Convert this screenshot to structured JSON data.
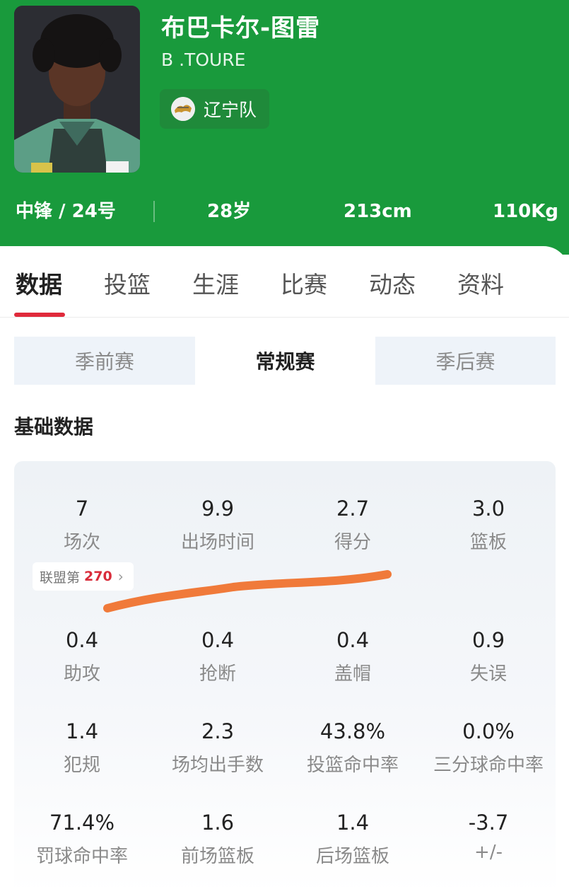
{
  "player": {
    "name": "布巴卡尔-图雷",
    "english_name": "B .TOURE",
    "team": "辽宁队",
    "position_number": "中锋 / 24号",
    "age": "28岁",
    "height": "213cm",
    "weight": "110Kg"
  },
  "tabs": [
    {
      "label": "数据",
      "active": true
    },
    {
      "label": "投篮",
      "active": false
    },
    {
      "label": "生涯",
      "active": false
    },
    {
      "label": "比赛",
      "active": false
    },
    {
      "label": "动态",
      "active": false
    },
    {
      "label": "资料",
      "active": false
    }
  ],
  "segments": [
    {
      "label": "季前赛",
      "selected": false
    },
    {
      "label": "常规赛",
      "selected": true
    },
    {
      "label": "季后赛",
      "selected": false
    }
  ],
  "section_title": "基础数据",
  "rank_badge": {
    "prefix": "联盟第",
    "value": "270"
  },
  "stats": [
    {
      "value": "7",
      "label": "场次"
    },
    {
      "value": "9.9",
      "label": "出场时间"
    },
    {
      "value": "2.7",
      "label": "得分"
    },
    {
      "value": "3.0",
      "label": "篮板"
    },
    {
      "value": "0.4",
      "label": "助攻"
    },
    {
      "value": "0.4",
      "label": "抢断"
    },
    {
      "value": "0.4",
      "label": "盖帽"
    },
    {
      "value": "0.9",
      "label": "失误"
    },
    {
      "value": "1.4",
      "label": "犯规"
    },
    {
      "value": "2.3",
      "label": "场均出手数"
    },
    {
      "value": "43.8%",
      "label": "投篮命中率"
    },
    {
      "value": "0.0%",
      "label": "三分球命中率"
    },
    {
      "value": "71.4%",
      "label": "罚球命中率"
    },
    {
      "value": "1.6",
      "label": "前场篮板"
    },
    {
      "value": "1.4",
      "label": "后场篮板"
    },
    {
      "value": "-3.7",
      "label": "+/-"
    }
  ],
  "colors": {
    "header_green": "#199a3c",
    "active_tab_underline": "#e02a3b",
    "rank_red": "#d92c3a",
    "annotation_stroke": "#f07a3a"
  },
  "icons": {
    "team_logo": "team-logo-icon",
    "chevron": "chevron-right-icon"
  }
}
